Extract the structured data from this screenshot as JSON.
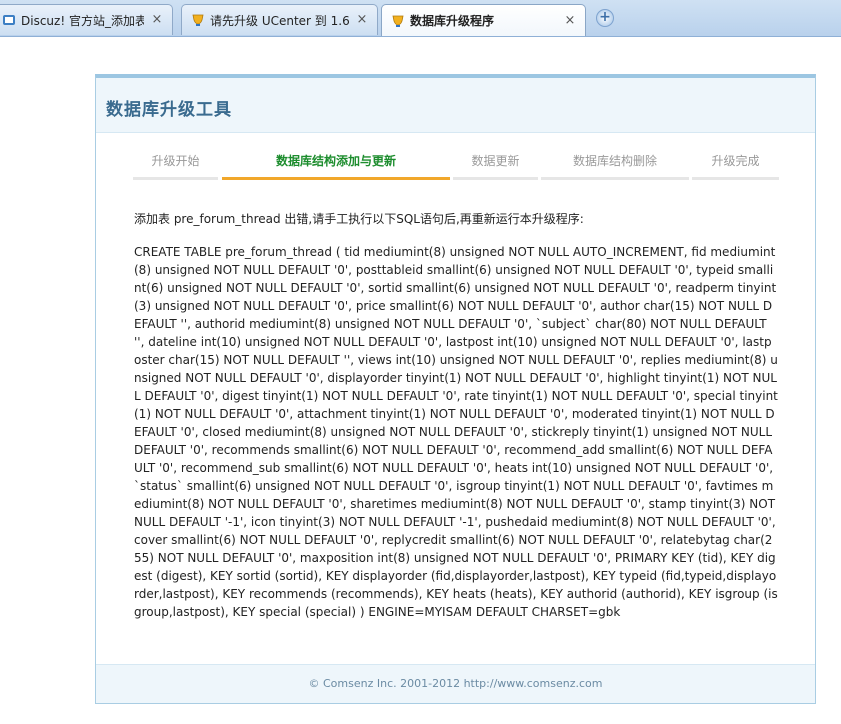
{
  "browser": {
    "tabs": [
      {
        "title": "Discuz! 官方站_添加表 pr...",
        "favicon": "discuz-icon",
        "active": false
      },
      {
        "title": "请先升级 UCenter 到 1.6....",
        "favicon": "discuz-icon",
        "active": false
      },
      {
        "title": "数据库升级程序",
        "favicon": "discuz-icon",
        "active": true
      }
    ],
    "close_glyph": "×",
    "new_tab_glyph": "+"
  },
  "header": {
    "title": "数据库升级工具"
  },
  "steps": [
    {
      "label": "升级开始",
      "current": false
    },
    {
      "label": "数据库结构添加与更新",
      "current": true
    },
    {
      "label": "数据更新",
      "current": false
    },
    {
      "label": "数据库结构删除",
      "current": false
    },
    {
      "label": "升级完成",
      "current": false
    }
  ],
  "content": {
    "message": "添加表 pre_forum_thread 出错,请手工执行以下SQL语句后,再重新运行本升级程序:",
    "sql": "CREATE TABLE pre_forum_thread ( tid mediumint(8) unsigned NOT NULL AUTO_INCREMENT, fid mediumint(8) unsigned NOT NULL DEFAULT '0', posttableid smallint(6) unsigned NOT NULL DEFAULT '0', typeid smallint(6) unsigned NOT NULL DEFAULT '0', sortid smallint(6) unsigned NOT NULL DEFAULT '0', readperm tinyint(3) unsigned NOT NULL DEFAULT '0', price smallint(6) NOT NULL DEFAULT '0', author char(15) NOT NULL DEFAULT '', authorid mediumint(8) unsigned NOT NULL DEFAULT '0', `subject` char(80) NOT NULL DEFAULT '', dateline int(10) unsigned NOT NULL DEFAULT '0', lastpost int(10) unsigned NOT NULL DEFAULT '0', lastposter char(15) NOT NULL DEFAULT '', views int(10) unsigned NOT NULL DEFAULT '0', replies mediumint(8) unsigned NOT NULL DEFAULT '0', displayorder tinyint(1) NOT NULL DEFAULT '0', highlight tinyint(1) NOT NULL DEFAULT '0', digest tinyint(1) NOT NULL DEFAULT '0', rate tinyint(1) NOT NULL DEFAULT '0', special tinyint(1) NOT NULL DEFAULT '0', attachment tinyint(1) NOT NULL DEFAULT '0', moderated tinyint(1) NOT NULL DEFAULT '0', closed mediumint(8) unsigned NOT NULL DEFAULT '0', stickreply tinyint(1) unsigned NOT NULL DEFAULT '0', recommends smallint(6) NOT NULL DEFAULT '0', recommend_add smallint(6) NOT NULL DEFAULT '0', recommend_sub smallint(6) NOT NULL DEFAULT '0', heats int(10) unsigned NOT NULL DEFAULT '0', `status` smallint(6) unsigned NOT NULL DEFAULT '0', isgroup tinyint(1) NOT NULL DEFAULT '0', favtimes mediumint(8) NOT NULL DEFAULT '0', sharetimes mediumint(8) NOT NULL DEFAULT '0', stamp tinyint(3) NOT NULL DEFAULT '-1', icon tinyint(3) NOT NULL DEFAULT '-1', pushedaid mediumint(8) NOT NULL DEFAULT '0', cover smallint(6) NOT NULL DEFAULT '0', replycredit smallint(6) NOT NULL DEFAULT '0', relatebytag char(255) NOT NULL DEFAULT '0', maxposition int(8) unsigned NOT NULL DEFAULT '0', PRIMARY KEY (tid), KEY digest (digest), KEY sortid (sortid), KEY displayorder (fid,displayorder,lastpost), KEY typeid (fid,typeid,displayorder,lastpost), KEY recommends (recommends), KEY heats (heats), KEY authorid (authorid), KEY isgroup (isgroup,lastpost), KEY special (special) ) ENGINE=MYISAM DEFAULT CHARSET=gbk"
  },
  "footer": {
    "text": "© Comsenz Inc. 2001-2012 http://www.comsenz.com"
  },
  "colors": {
    "accent_green": "#1d8d2e",
    "accent_orange": "#f1a72a",
    "header_title": "#3a6b8f",
    "panel_bg": "#eef6fb"
  }
}
